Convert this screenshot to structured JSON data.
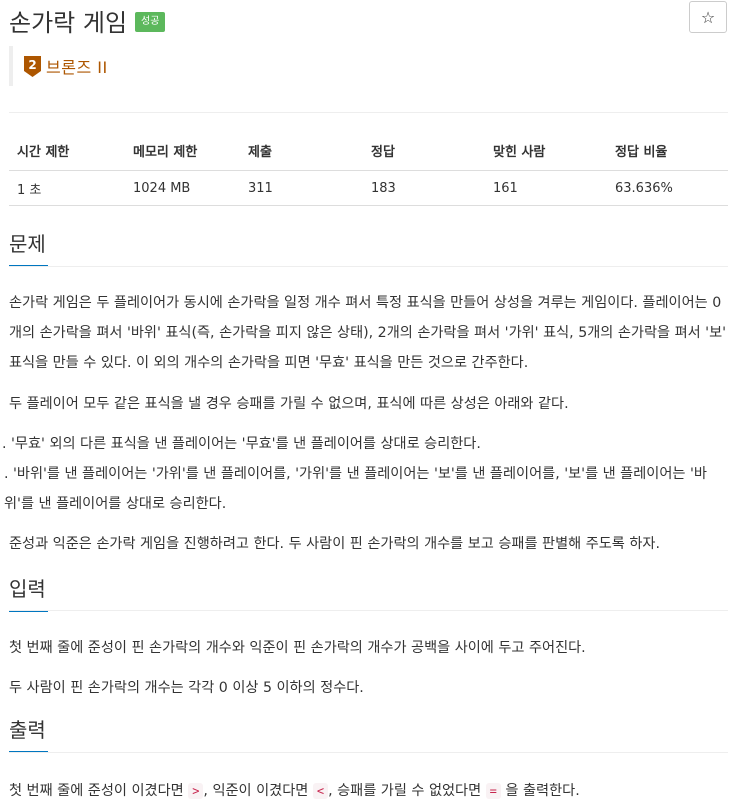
{
  "problem": {
    "title": "손가락 게임",
    "status_badge": "성공",
    "star_icon": "☆",
    "tier_number": "2",
    "tier_label": "브론즈 II",
    "tier_color": "#ad5600"
  },
  "stats": {
    "headers": [
      "시간 제한",
      "메모리 제한",
      "제출",
      "정답",
      "맞힌 사람",
      "정답 비율"
    ],
    "values": [
      "1 초",
      "1024 MB",
      "311",
      "183",
      "161",
      "63.636%"
    ]
  },
  "sections": {
    "description_title": "문제",
    "description_p1": "손가락 게임은 두 플레이어가 동시에 손가락을 일정 개수 펴서 특정 표식을 만들어 상성을 겨루는 게임이다. 플레이어는 0개의 손가락을 펴서 '바위' 표식(즉, 손가락을 피지 않은 상태), 2개의 손가락을 펴서 '가위' 표식, 5개의 손가락을 펴서 '보' 표식을 만들 수 있다. 이 외의 개수의 손가락을 피면 '무효' 표식을 만든 것으로 간주한다.",
    "description_p2": "두 플레이어 모두 같은 표식을 낼 경우 승패를 가릴 수 없으며, 표식에 따른 상성은 아래와 같다.",
    "rule1": "'무효' 외의 다른 표식을 낸 플레이어는 '무효'를 낸 플레이어를 상대로 승리한다.",
    "rule2": "'바위'를 낸 플레이어는 '가위'를 낸 플레이어를, '가위'를 낸 플레이어는 '보'를 낸 플레이어를, '보'를 낸 플레이어는 '바위'를 낸 플레이어를 상대로 승리한다.",
    "description_p3": "준성과 익준은 손가락 게임을 진행하려고 한다. 두 사람이 핀 손가락의 개수를 보고 승패를 판별해 주도록 하자.",
    "input_title": "입력",
    "input_p1": "첫 번째 줄에 준성이 핀 손가락의 개수와 익준이 핀 손가락의 개수가 공백을 사이에 두고 주어진다.",
    "input_p2": "두 사람이 핀 손가락의 개수는 각각 0 이상 5 이하의 정수다.",
    "output_title": "출력",
    "output_prefix": "첫 번째 줄에 준성이 이겼다면",
    "output_mark1": ">",
    "output_mid1": ", 익준이 이겼다면",
    "output_mark2": "<",
    "output_mid2": ", 승패를 가릴 수 없었다면",
    "output_mark3": "=",
    "output_suffix": "을 출력한다."
  }
}
